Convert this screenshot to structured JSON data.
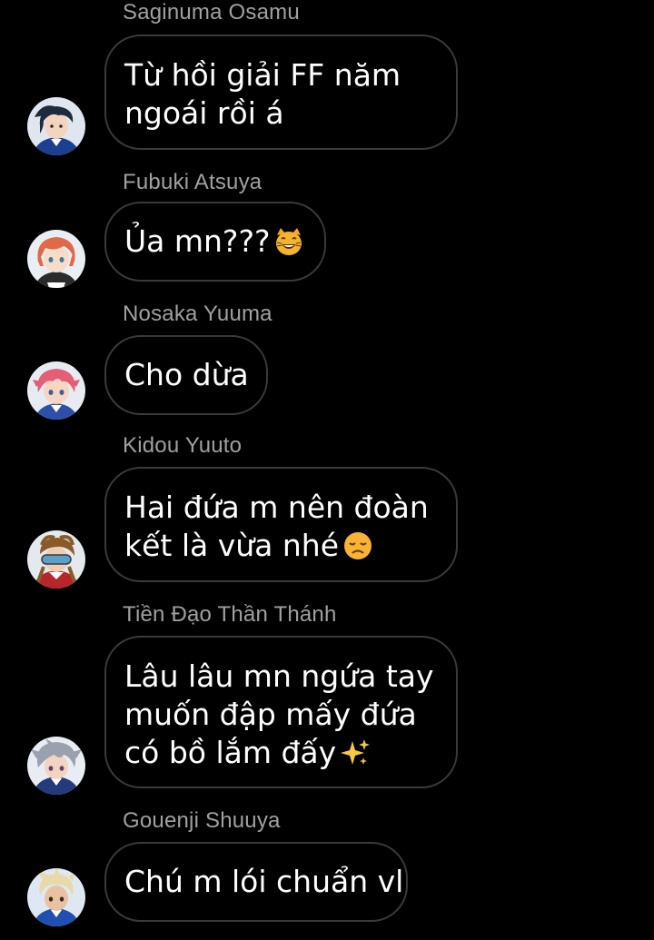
{
  "messages": [
    {
      "sender": "Saginuma Osamu",
      "lines": [
        "Từ hồi giải FF năm",
        "ngoái rồi á"
      ],
      "emoji": null,
      "avatar_icon": "avatar-dark-hair-icon"
    },
    {
      "sender": "Fubuki Atsuya",
      "lines": [
        "Ủa mn???"
      ],
      "emoji": "smiling-cat-emoji",
      "avatar_icon": "avatar-orange-hair-icon"
    },
    {
      "sender": "Nosaka Yuuma",
      "lines": [
        "Cho dừa"
      ],
      "emoji": null,
      "avatar_icon": "avatar-pink-hair-icon"
    },
    {
      "sender": "Kidou Yuuto",
      "lines": [
        "Hai đứa m nên đoàn",
        "kết là vừa nhé"
      ],
      "emoji": "disappointed-face-emoji",
      "avatar_icon": "avatar-goggles-icon"
    },
    {
      "sender": "Tiền Đạo Thần Thánh",
      "lines": [
        "Lâu lâu mn ngứa tay",
        "muốn đập mấy đứa",
        "có bồ lắm đấy"
      ],
      "emoji": "sparkles-emoji",
      "avatar_icon": "avatar-silver-hair-icon"
    },
    {
      "sender": "Gouenji Shuuya",
      "lines": [
        "Chú m lói chuẩn vl"
      ],
      "emoji": null,
      "avatar_icon": "avatar-blond-hair-icon"
    }
  ],
  "colors": {
    "background": "#000000",
    "bubble_border": "#3a3a3a",
    "sender_text": "#a0a0a0",
    "message_text": "#ffffff"
  }
}
